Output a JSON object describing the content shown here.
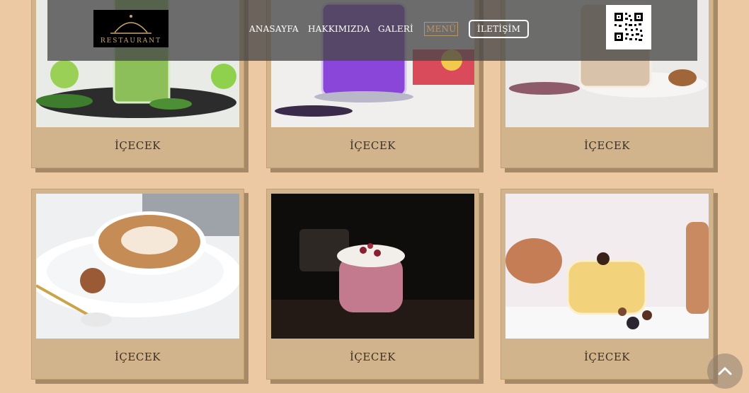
{
  "nav": {
    "logo_text": "RESTAURANT",
    "links": [
      "ANASAYFA",
      "HAKKIMIZDA",
      "GALERİ",
      "MENÜ"
    ],
    "contact": "İLETİŞİM",
    "active_index": 3
  },
  "menu": {
    "items": [
      {
        "label": "İÇECEK",
        "photo": "green-smoothie-icon"
      },
      {
        "label": "İÇECEK",
        "photo": "purple-drink-icon"
      },
      {
        "label": "İÇECEK",
        "photo": "iced-latte-icon"
      },
      {
        "label": "İÇECEK",
        "photo": "cappuccino-icon"
      },
      {
        "label": "İÇECEK",
        "photo": "berry-dessert-drink-icon"
      },
      {
        "label": "İÇECEK",
        "photo": "golden-cocktail-icon"
      }
    ]
  },
  "colors": {
    "background": "#ecc9a3",
    "card": "#d2b48c",
    "accent": "#b8956a"
  }
}
